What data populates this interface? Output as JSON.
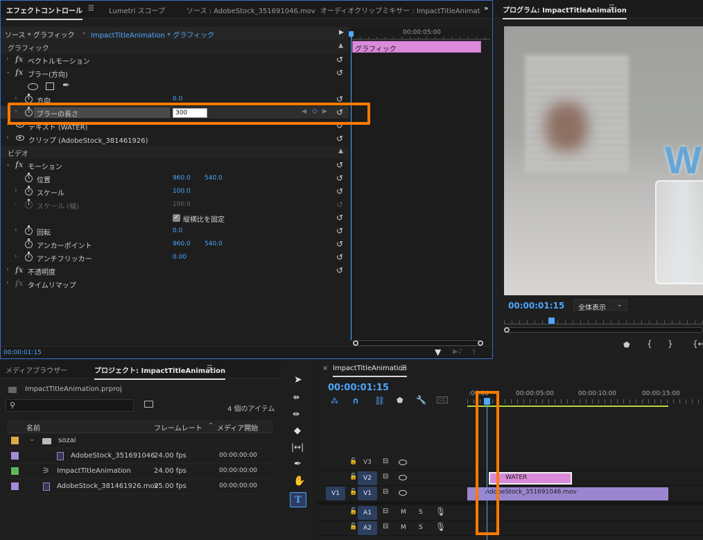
{
  "effect_controls": {
    "tabs": {
      "effect_controls": "エフェクトコントロール",
      "lumetri": "Lumetri スコープ",
      "source": "ソース : AdobeStock_351691046.mov",
      "audio_mixer": "オーディオクリップミキサー : ImpactTitleAnimat"
    },
    "source_label": "ソース * グラフィック",
    "sequence_label": "ImpactTitleAnimation * グラフィック",
    "timecode_ruler": "00:00:05:00",
    "clip_bar_label": "グラフィック",
    "section_graphics": "グラフィック",
    "section_video": "ビデオ",
    "vector_motion": "ベクトルモーション",
    "blur_dir": "ブラー(方向)",
    "direction_label": "方向",
    "direction_value": "0.0",
    "blur_length_label": "ブラーの長さ",
    "blur_length_value": "300",
    "text_layer": "テキスト (WATER)",
    "clip_layer": "クリップ (AdobeStock_381461926)",
    "motion": "モーション",
    "position_label": "位置",
    "position_x": "960.0",
    "position_y": "540.0",
    "scale_label": "スケール",
    "scale_value": "100.0",
    "scale_width_label": "スケール (幅)",
    "scale_width_value": "100.0",
    "uniform_scale": "縦横比を固定",
    "rotation_label": "回転",
    "rotation_value": "0.0",
    "anchor_label": "アンカーポイント",
    "anchor_x": "960.0",
    "anchor_y": "540.0",
    "antiflicker_label": "アンチフリッカー",
    "antiflicker_value": "0.00",
    "opacity": "不透明度",
    "time_remap": "タイムリマップ",
    "footer_timecode": "00:00:01:15"
  },
  "program_monitor": {
    "title": "プログラム: ImpactTitleAnimation",
    "timecode": "00:00:01:15",
    "fit_label": "全体表示",
    "preview_text": "W"
  },
  "project": {
    "tab_media_browser": "メディアブラウザー",
    "tab_project": "プロジェクト: ImpactTitleAnimation",
    "file_name": "ImpactTitleAnimation.prproj",
    "item_count": "4 個のアイテム",
    "col_name": "名前",
    "col_framerate": "フレームレート",
    "col_media_start": "メディア開始",
    "items": [
      {
        "name": "sozai",
        "fps": "",
        "start": "",
        "color": "#e0a84a"
      },
      {
        "name": "AdobeStock_351691046.",
        "fps": "24.00 fps",
        "start": "00:00:00:00",
        "color": "#a58ad6"
      },
      {
        "name": "ImpactTitleAnimation",
        "fps": "24.00 fps",
        "start": "00:00:00:00",
        "color": "#5cb85c"
      },
      {
        "name": "AdobeStock_381461926.mov",
        "fps": "25.00 fps",
        "start": "00:00:00:00",
        "color": "#a58ad6"
      }
    ]
  },
  "timeline": {
    "title": "ImpactTitleAnimation",
    "timecode": "00:00:01:15",
    "ruler": [
      "00:00:05:00",
      "00:00:10:00",
      "00:00:15:00"
    ],
    "ruler_start": ":00:00",
    "tracks": {
      "v3": "V3",
      "v2": "V2",
      "v1": "V1",
      "a1": "A1",
      "a2": "A2",
      "v1_src": "V1",
      "m": "M",
      "s": "S"
    },
    "clip_water": "WATER",
    "clip_stock": "AdobeStock_351691046.mov"
  },
  "colors": {
    "accent_blue": "#4ea6ff",
    "highlight_orange": "#ff7a00",
    "graphic_clip": "#d98ad9",
    "video_clip": "#9a86cf"
  }
}
